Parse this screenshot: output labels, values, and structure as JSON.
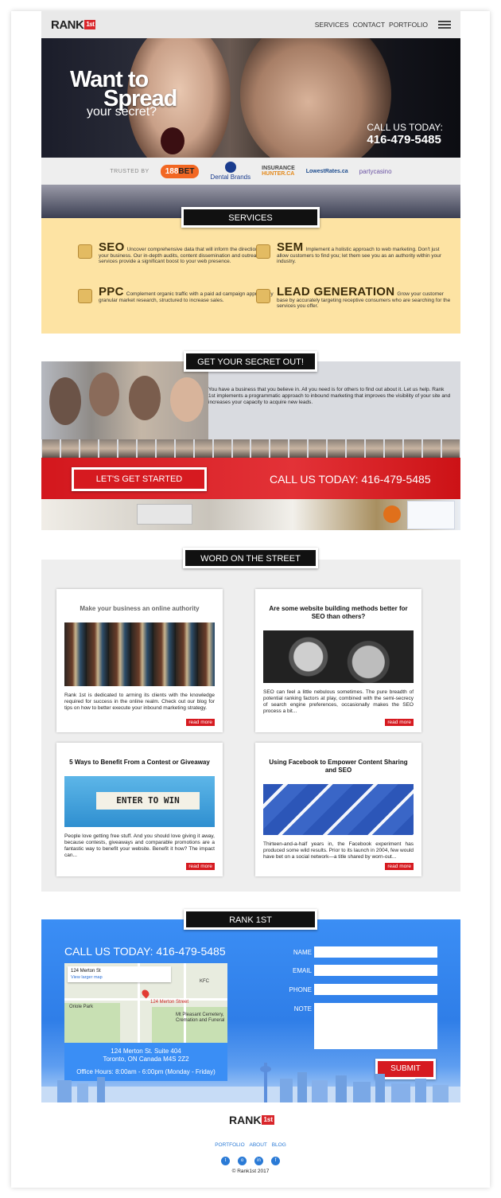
{
  "header": {
    "logo_text": "RANK",
    "logo_badge": "1st",
    "nav": [
      "SERVICES",
      "CONTACT",
      "PORTFOLIO"
    ]
  },
  "hero": {
    "title_line1": "Want to",
    "title_line2": "Spread",
    "subtitle": "your secret?",
    "call_label": "CALL US TODAY:",
    "call_number": "416-479-5485"
  },
  "trusted": {
    "label": "TRUSTED BY",
    "brands": {
      "bet_a": "188",
      "bet_b": "BET",
      "dental": "Dental Brands",
      "insurance_a": "INSURANCE",
      "insurance_b": "HUNTER.CA",
      "lowest": "LowestRates.ca",
      "party": "partycasino"
    }
  },
  "services": {
    "heading": "SERVICES",
    "items": [
      {
        "title": "SEO",
        "text": "Uncover comprehensive data that will inform the direction of your business. Our in-depth audits, content dissemination and outreach services provide a significant boost to your web presence.",
        "icon": "magnifier-icon"
      },
      {
        "title": "SEM",
        "text": "Implement a holistic approach to web marketing. Don't just allow customers to find you; let them see you as an authority within your industry.",
        "icon": "person-icon"
      },
      {
        "title": "PPC",
        "text": "Complement organic traffic with a paid ad campaign apprised by granular market research, structured to increase sales.",
        "icon": "dollar-icon"
      },
      {
        "title": "LEAD GENERATION",
        "text": "Grow your customer base by accurately targeting receptive consumers who are searching for the services you offer.",
        "icon": "star-person-icon"
      }
    ]
  },
  "secret": {
    "heading": "GET YOUR SECRET OUT!",
    "text": "You have a business that you believe in. All you need is for others to find out about it. Let us help. Rank 1st implements a programmatic approach to inbound marketing that improves the visibility of your site and increases your capacity to acquire new leads.",
    "cta": "LET'S GET STARTED",
    "call": "CALL US TODAY: 416-479-5485"
  },
  "street": {
    "heading": "WORD ON THE STREET",
    "read_more": "read more",
    "posts": [
      {
        "title": "Make your business an online authority",
        "text": "Rank 1st is dedicated to arming its clients with the knowledge required for success in the online realm. Check out our blog for tips on how to better execute your inbound marketing strategy."
      },
      {
        "title": "Are some website building methods better for SEO than others?",
        "text": "SEO can feel a little nebulous sometimes. The pure breadth of potential ranking factors at play, combined with the semi-secrecy of search engine preferences, occasionally makes the SEO process a bit..."
      },
      {
        "title": "5 Ways to Benefit From a Contest or Giveaway",
        "text": "People love getting free stuff. And you should love giving it away, because contests, giveaways and comparable promotions are a fantastic way to benefit your website. Benefit it how? The impact can...",
        "banner": "ENTER TO WIN"
      },
      {
        "title": "Using Facebook to Empower Content Sharing and SEO",
        "text": "Thirteen-and-a-half years in, the Facebook experiment has produced some wild results. Prior to its launch in 2004, few would have bet on a social network—a title shared by worn-out..."
      }
    ]
  },
  "contact": {
    "heading": "RANK 1ST",
    "call": "CALL US TODAY: 416-479-5485",
    "map_place": "124 Merton St",
    "map_link": "View larger map",
    "map_pin_label": "124 Merton Street",
    "map_labels": [
      "Oriole Park",
      "Mt Pleasant Cemetery, Cremation and Funeral",
      "KFC"
    ],
    "address_line1": "124 Merton St. Suite 404",
    "address_line2": "Toronto, ON Canada   M4S 2Z2",
    "hours": "Office Hours: 8:00am - 6:00pm (Monday - Friday)",
    "form": {
      "name": "NAME",
      "email": "EMAIL",
      "phone": "PHONE",
      "note": "NOTE",
      "submit": "SUBMIT"
    }
  },
  "footer": {
    "logo_text": "RANK",
    "logo_badge": "1st",
    "nav": [
      "PORTFOLIO",
      "ABOUT",
      "BLOG"
    ],
    "social": [
      "twitter-icon",
      "instagram-icon",
      "linkedin-icon",
      "facebook-icon"
    ],
    "copyright": "© Rank1st 2017"
  }
}
